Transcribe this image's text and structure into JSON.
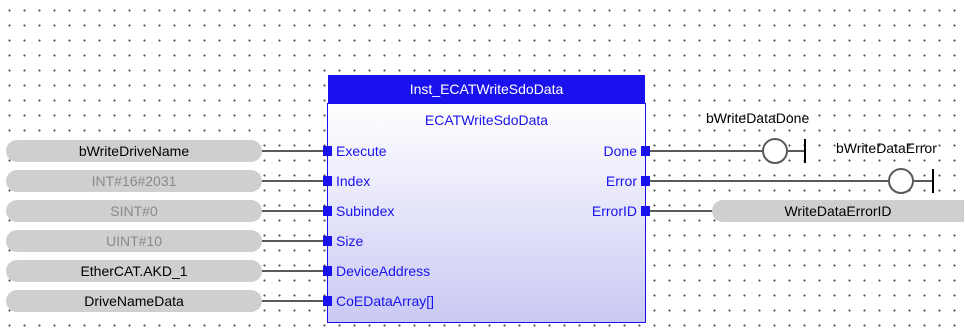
{
  "block": {
    "instance_name": "Inst_ECATWriteSdoData",
    "type_name": "ECATWriteSdoData",
    "inputs": [
      "Execute",
      "Index",
      "Subindex",
      "Size",
      "DeviceAddress",
      "CoEDataArray[]"
    ],
    "outputs": [
      "Done",
      "Error",
      "ErrorID"
    ]
  },
  "input_vars": [
    {
      "text": "bWriteDriveName",
      "style": "variable"
    },
    {
      "text": "INT#16#2031",
      "style": "constant"
    },
    {
      "text": "SINT#0",
      "style": "constant"
    },
    {
      "text": "UINT#10",
      "style": "constant"
    },
    {
      "text": "EtherCAT.AKD_1",
      "style": "variable"
    },
    {
      "text": "DriveNameData",
      "style": "variable"
    }
  ],
  "outputs": {
    "done_coil_label": "bWriteDataDone",
    "error_coil_label": "bWriteDataError",
    "errorid_var": "WriteDataErrorID"
  },
  "colors": {
    "block_blue": "#1a12ee",
    "pill_gray": "#cfcfcf",
    "constant_text": "#8a8a8a",
    "wire": "#5a5a5a"
  }
}
